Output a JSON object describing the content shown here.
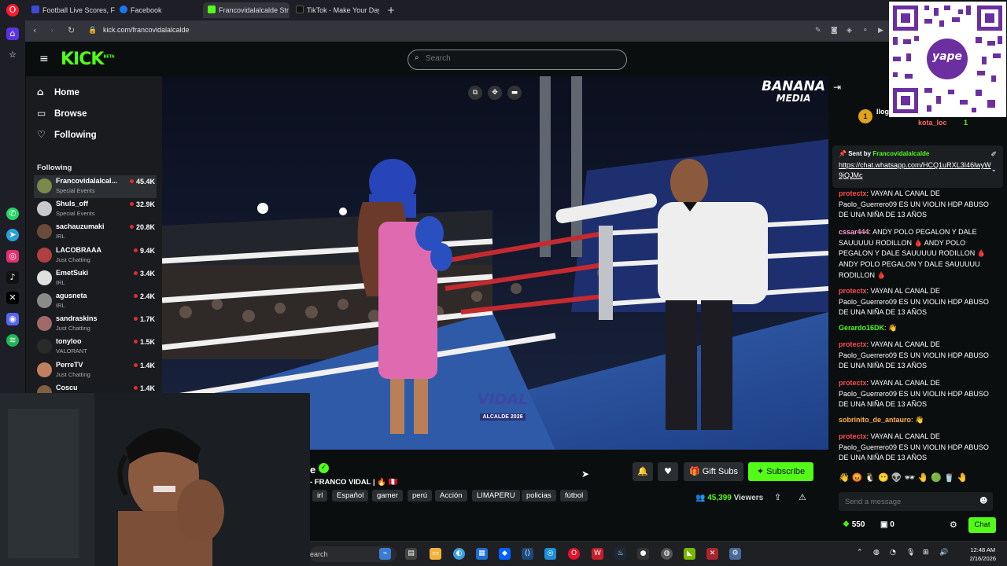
{
  "browser": {
    "tabs": [
      {
        "label": "Football Live Scores, Fixtu",
        "color": "#3b4bd4",
        "active": false
      },
      {
        "label": "Facebook",
        "color": "#1877f2",
        "active": false
      },
      {
        "label": "Francovidalalcalde Str",
        "color": "#53fc18",
        "active": true
      },
      {
        "label": "TikTok - Make Your Day",
        "color": "#111111",
        "active": false
      }
    ],
    "new_tab_icon": "plus-icon",
    "url": "kick.com/francovidalalcalde"
  },
  "kick": {
    "logo": "KICK",
    "logo_beta": "BETA",
    "search_placeholder": "Search"
  },
  "sidebar": {
    "nav": [
      {
        "label": "Home",
        "icon": "home-icon"
      },
      {
        "label": "Browse",
        "icon": "browse-icon"
      },
      {
        "label": "Following",
        "icon": "heart-icon"
      }
    ],
    "following_heading": "Following",
    "channels": [
      {
        "name": "Francovidalalcal...",
        "category": "Special Events",
        "viewers": "45.4K",
        "color": "#7b8a4a",
        "selected": true
      },
      {
        "name": "Shuls_off",
        "category": "Special Events",
        "viewers": "32.9K",
        "color": "#c9c9c9",
        "selected": false
      },
      {
        "name": "sachauzumaki",
        "category": "IRL",
        "viewers": "20.8K",
        "color": "#6a4a3a",
        "selected": false
      },
      {
        "name": "LACOBRAAA",
        "category": "Just Chatting",
        "viewers": "9.4K",
        "color": "#b04040",
        "selected": false
      },
      {
        "name": "EmetSuki",
        "category": "IRL",
        "viewers": "3.4K",
        "color": "#e0e0e0",
        "selected": false
      },
      {
        "name": "agusneta",
        "category": "IRL",
        "viewers": "2.4K",
        "color": "#8a8a8a",
        "selected": false
      },
      {
        "name": "sandraskins",
        "category": "Just Chatting",
        "viewers": "1.7K",
        "color": "#a06a6a",
        "selected": false
      },
      {
        "name": "tonyloo",
        "category": "VALORANT",
        "viewers": "1.5K",
        "color": "#2a2a2a",
        "selected": false
      },
      {
        "name": "PerreTV",
        "category": "Just Chatting",
        "viewers": "1.4K",
        "color": "#c08060",
        "selected": false
      },
      {
        "name": "Coscu",
        "category": "",
        "viewers": "1.4K",
        "color": "#806040",
        "selected": false
      }
    ]
  },
  "video": {
    "watermark_line1": "BANANA",
    "watermark_line2": "MEDIA",
    "overlay_vidal": "VIDAL",
    "overlay_alcalde": "ALCALDE 2026"
  },
  "stream": {
    "title_fragment": "e",
    "title": "- FRANCO VIDAL |",
    "tags": [
      "irl",
      "Español",
      "gamer",
      "perú",
      "Acción",
      "LIMAPERU",
      "policias",
      "fútbol"
    ],
    "gift_label": "Gift Subs",
    "subscribe_label": "Subscribe",
    "viewers_count": "45,399",
    "viewers_label": "Viewers"
  },
  "chat": {
    "top_rank": "1",
    "top_users": [
      "llog",
      "kota_loc"
    ],
    "top_user_count": "1",
    "pinned_sent_by_label": "Sent by",
    "pinned_sender": "Francovidalalcalde",
    "pinned_link": "https://chat.whatsapp.com/HCQ1uRXL3I46lwyW9jQJMc",
    "messages": [
      {
        "user": "protectx",
        "color": "#ff4d4d",
        "text": "VAYAN AL CANAL DE Paolo_Guerrero09 ES UN VIOLIN HDP ABUSO DE UNA NIÑA DE 13 AÑOS"
      },
      {
        "user": "cssar444",
        "color": "#ff9ecb",
        "text": "ANDY POLO PEGALON Y DALE SAUUUUU RODILLON 🩸 ANDY POLO PEGALON Y DALE SAUUUUU RODILLON 🩸 ANDY POLO PEGALON Y DALE SAUUUUU RODILLON 🩸"
      },
      {
        "user": "protectx",
        "color": "#ff4d4d",
        "text": "VAYAN AL CANAL DE Paolo_Guerrero09 ES UN VIOLIN HDP ABUSO DE UNA NIÑA DE 13 AÑOS"
      },
      {
        "user": "Gerardo16DK",
        "color": "#53fc18",
        "text": "👋"
      },
      {
        "user": "protectx",
        "color": "#ff4d4d",
        "text": "VAYAN AL CANAL DE Paolo_Guerrero09 ES UN VIOLIN HDP ABUSO DE UNA NIÑA DE 13 AÑOS"
      },
      {
        "user": "protectx",
        "color": "#ff4d4d",
        "text": "VAYAN AL CANAL DE Paolo_Guerrero09 ES UN VIOLIN HDP ABUSO DE UNA NIÑA DE 13 AÑOS"
      },
      {
        "user": "sobrinito_de_antauro",
        "color": "#ffb347",
        "text": "👋"
      },
      {
        "user": "protectx",
        "color": "#ff4d4d",
        "text": "VAYAN AL CANAL DE Paolo_Guerrero09 ES UN VIOLIN HDP ABUSO DE UNA NIÑA DE 13 AÑOS"
      }
    ],
    "input_placeholder": "Send a message",
    "points": "550",
    "gifts": "0",
    "chat_button": "Chat"
  },
  "taskbar": {
    "search_label": "earch",
    "time": "12:48 AM",
    "date": "2/16/2026"
  },
  "qr": {
    "brand": "yape"
  },
  "colors": {
    "accent": "#53fc18",
    "background": "#0b0e0f",
    "sidebar": "#191b1f"
  }
}
